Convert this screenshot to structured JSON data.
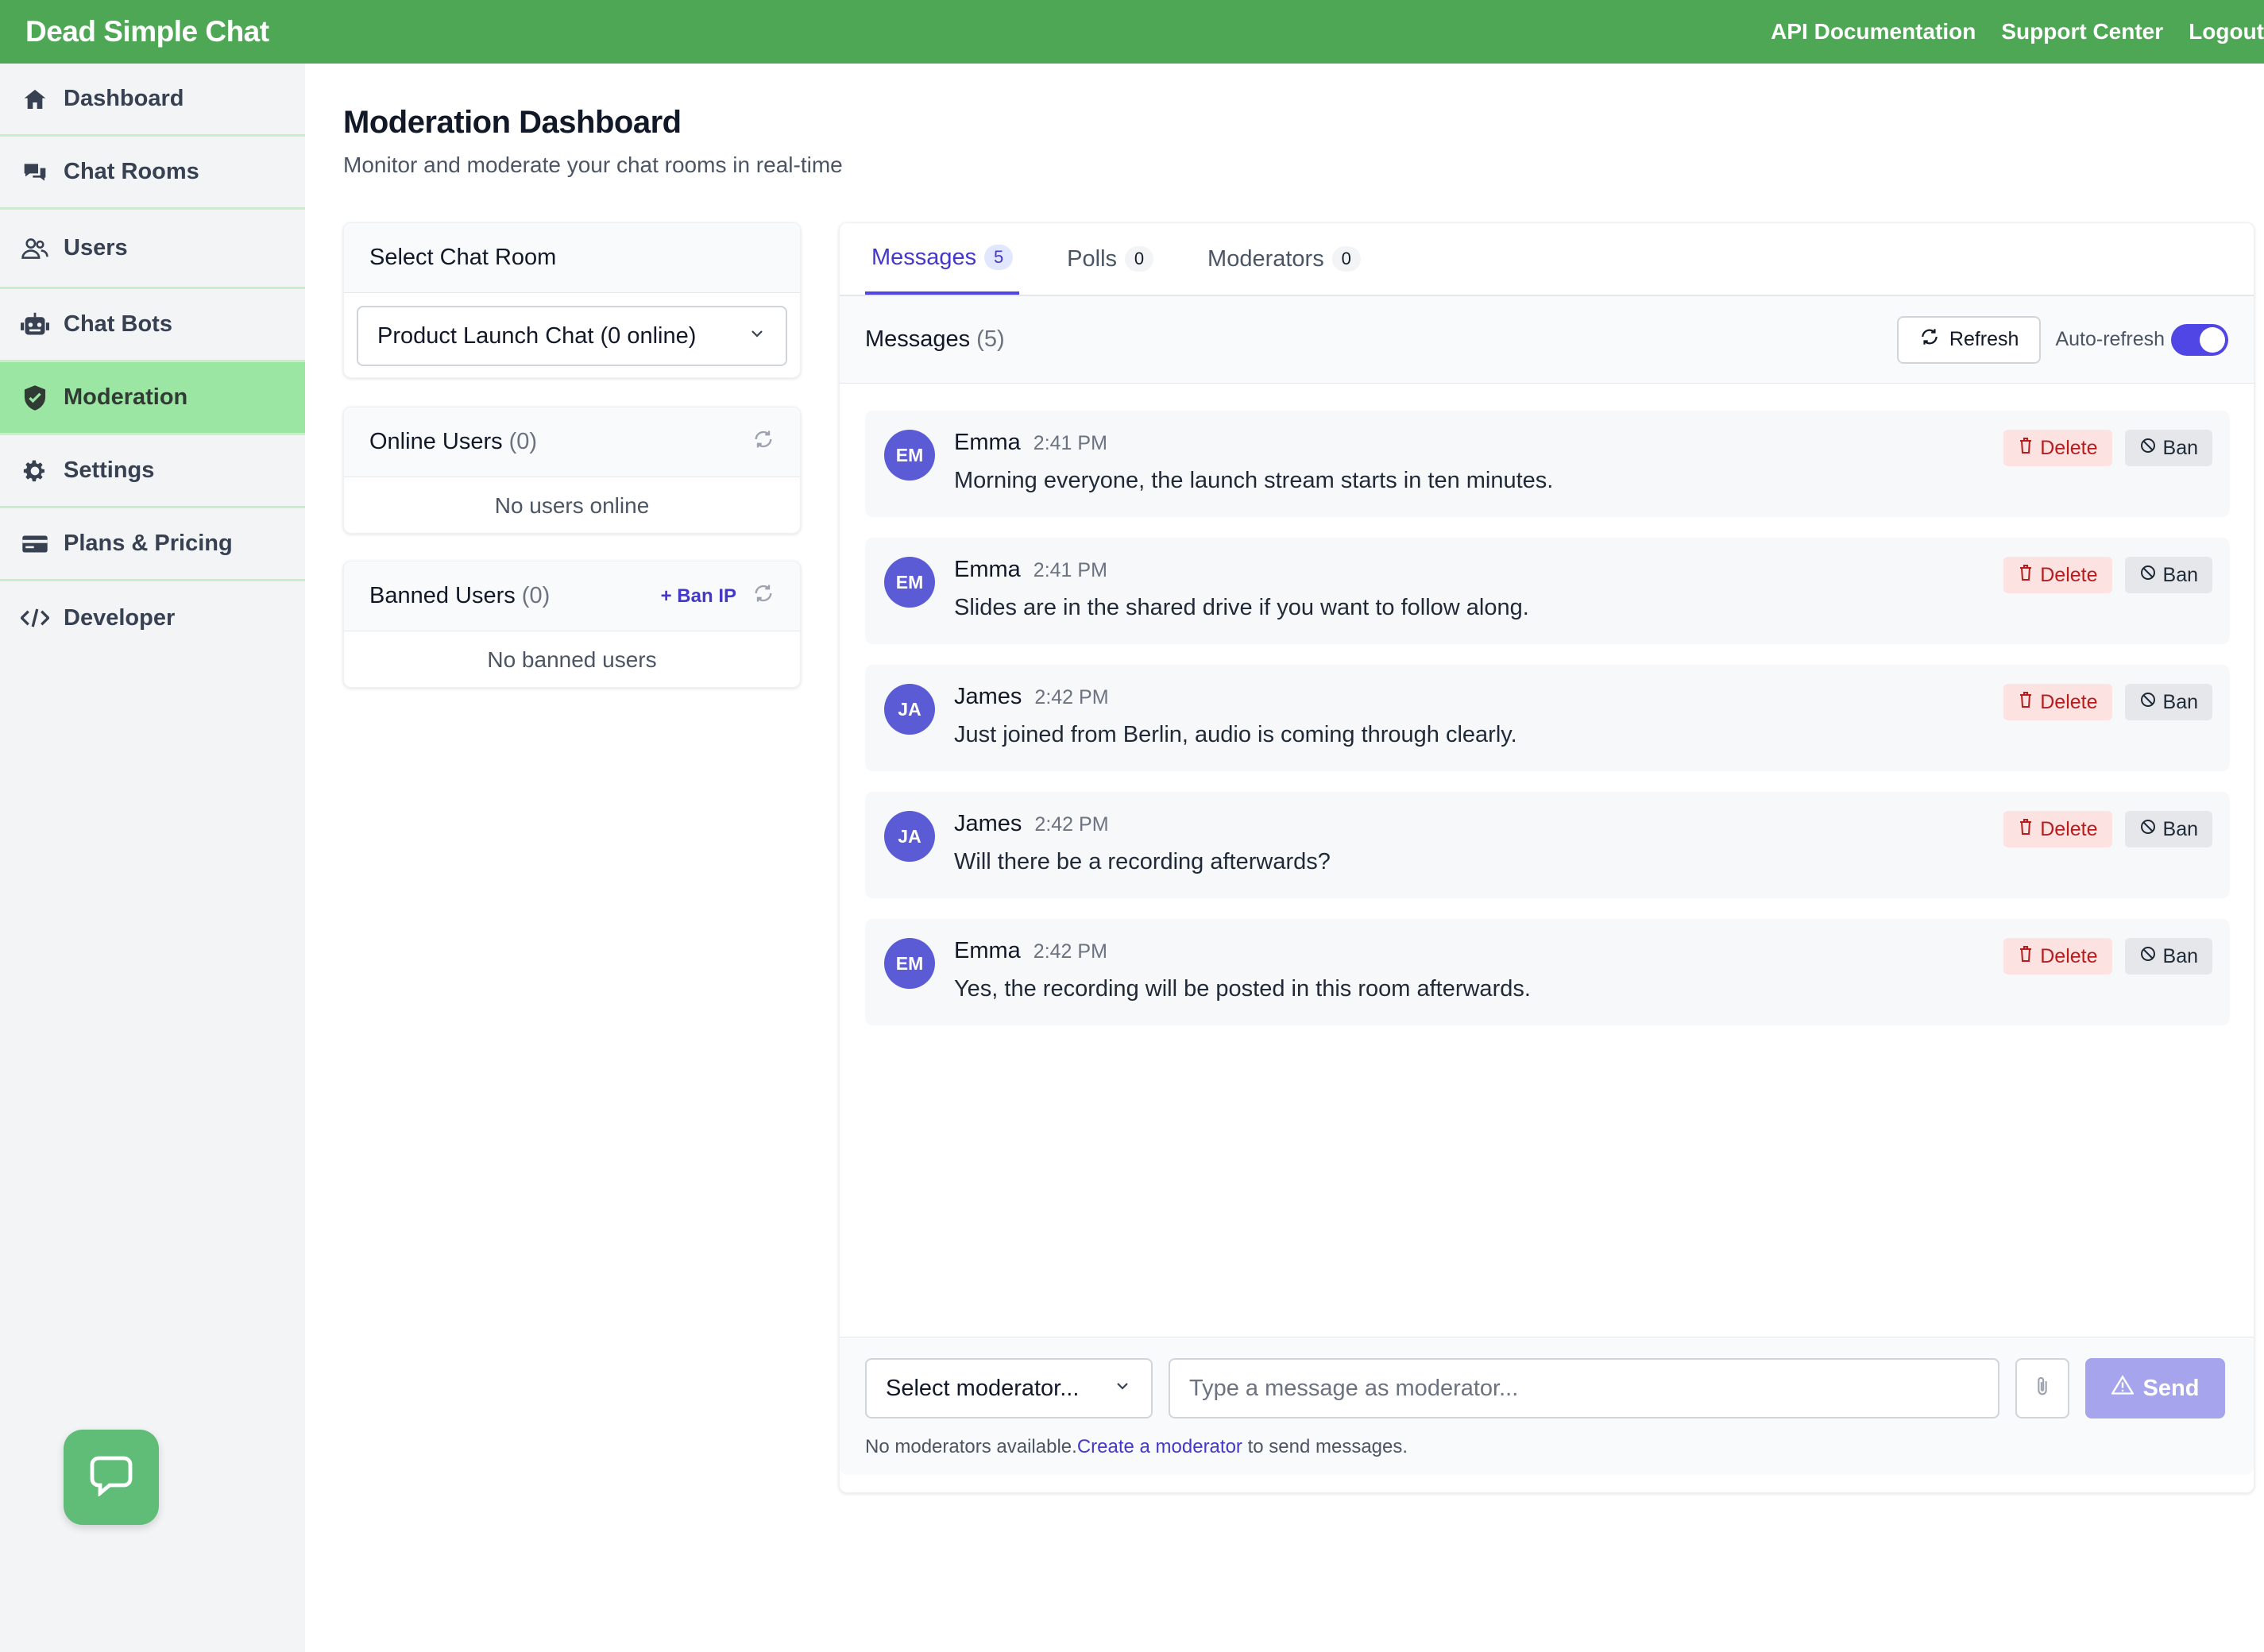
{
  "app": {
    "brand": "Dead Simple Chat",
    "top_links": [
      "API Documentation",
      "Support Center",
      "Logout"
    ]
  },
  "sidebar": {
    "items": [
      {
        "label": "Dashboard",
        "icon": "home-icon"
      },
      {
        "label": "Chat Rooms",
        "icon": "chat-bubbles-icon"
      },
      {
        "label": "Users",
        "icon": "users-icon"
      },
      {
        "label": "Chat Bots",
        "icon": "robot-icon"
      },
      {
        "label": "Moderation",
        "icon": "shield-icon",
        "active": true
      },
      {
        "label": "Settings",
        "icon": "gear-icon"
      },
      {
        "label": "Plans & Pricing",
        "icon": "credit-card-icon"
      },
      {
        "label": "Developer",
        "icon": "code-icon"
      }
    ]
  },
  "page": {
    "title": "Moderation Dashboard",
    "subtitle": "Monitor and moderate your chat rooms in real-time"
  },
  "room_select": {
    "heading": "Select Chat Room",
    "selected": "Product Launch Chat (0 online)"
  },
  "online_users": {
    "heading": "Online Users",
    "count": "(0)",
    "empty": "No users online"
  },
  "banned_users": {
    "heading": "Banned Users",
    "count": "(0)",
    "ban_ip_label": "+ Ban IP",
    "empty": "No banned users"
  },
  "tabs": [
    {
      "label": "Messages",
      "badge": "5",
      "active": true
    },
    {
      "label": "Polls",
      "badge": "0"
    },
    {
      "label": "Moderators",
      "badge": "0"
    }
  ],
  "messages_panel": {
    "heading": "Messages",
    "count": "(5)",
    "refresh_label": "Refresh",
    "auto_refresh_label": "Auto-refresh",
    "auto_refresh_on": true
  },
  "messages": [
    {
      "initials": "EM",
      "name": "Emma",
      "time": "2:41 PM",
      "text": "Morning everyone, the launch stream starts in ten minutes."
    },
    {
      "initials": "EM",
      "name": "Emma",
      "time": "2:41 PM",
      "text": "Slides are in the shared drive if you want to follow along."
    },
    {
      "initials": "JA",
      "name": "James",
      "time": "2:42 PM",
      "text": "Just joined from Berlin, audio is coming through clearly."
    },
    {
      "initials": "JA",
      "name": "James",
      "time": "2:42 PM",
      "text": "Will there be a recording afterwards?"
    },
    {
      "initials": "EM",
      "name": "Emma",
      "time": "2:42 PM",
      "text": "Yes, the recording will be posted in this room afterwards."
    }
  ],
  "message_actions": {
    "delete_label": "Delete",
    "ban_label": "Ban"
  },
  "composer": {
    "moderator_select": "Select moderator...",
    "input_placeholder": "Type a message as moderator...",
    "send_label": "Send",
    "note_prefix": "No moderators available.",
    "note_link": "Create a moderator",
    "note_suffix": " to send messages."
  },
  "colors": {
    "brand_green": "#4ea754",
    "active_nav": "#9be6a2",
    "accent": "#4f46e5",
    "delete_bg": "#fde2e2",
    "send_disabled": "#a5a4ec"
  }
}
